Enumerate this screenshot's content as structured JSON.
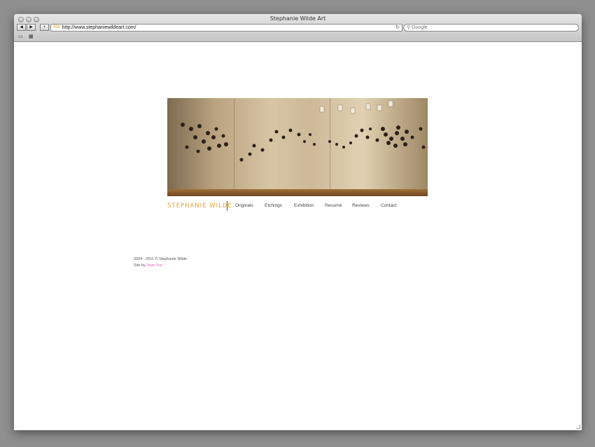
{
  "browser": {
    "title": "Stephanie Wilde Art",
    "url": "http://www.stephaniewildeart.com/",
    "search_placeholder": "Google",
    "back_glyph": "◀",
    "forward_glyph": "▶",
    "add_glyph": "+",
    "reload_glyph": "↻",
    "favicon_glyph": "SW",
    "bookmarks_glyph": "▭",
    "topsites_glyph": "▦"
  },
  "site": {
    "brand": "STEPHANIE  WILDE",
    "nav": [
      "Originals",
      "Etchings",
      "Exhibition",
      "Resumé",
      "Reviews",
      "Contact"
    ],
    "footer_copyright": "2004 - 2011 © Stephanie Wilde",
    "footer_site_by": "Site by",
    "footer_credit": "Jean You"
  },
  "colors": {
    "brand": "#e3a034",
    "credit_link": "#e85fb0"
  }
}
